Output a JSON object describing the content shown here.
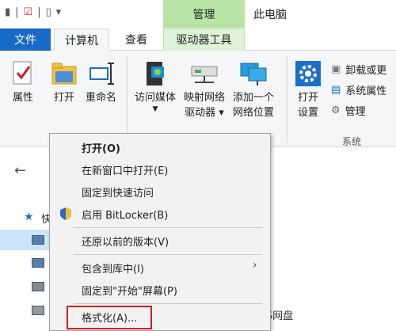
{
  "titlebar": {
    "manage_tab": "管理",
    "window_title": "此电脑"
  },
  "tabs": {
    "file": "文件",
    "computer": "计算机",
    "view": "查看",
    "drive_tools": "驱动器工具"
  },
  "ribbon": {
    "properties": "属性",
    "open": "打开",
    "rename": "重命名",
    "access_media_1": "访问媒体",
    "map_drive_1": "映射网络",
    "map_drive_2": "驱动器",
    "add_location_1": "添加一个",
    "add_location_2": "网络位置",
    "open_settings_1": "打开",
    "open_settings_2": "设置",
    "uninstall": "卸载或更",
    "system_properties": "系统属性",
    "manage": "管理",
    "group_system": "系统"
  },
  "nav": {
    "sidebar_k": "快"
  },
  "context_menu": {
    "items": [
      {
        "label": "打开(O)"
      },
      {
        "label": "在新窗口中打开(E)"
      },
      {
        "label": "固定到快速访问"
      },
      {
        "label": "启用 BitLocker(B)"
      },
      {
        "label": "还原以前的版本(V)"
      },
      {
        "label": "包含到库中(I)"
      },
      {
        "label": "固定到\"开始\"屏幕(P)"
      },
      {
        "label": "格式化(A)..."
      }
    ]
  },
  "bottom": {
    "text": "PS网盘"
  }
}
